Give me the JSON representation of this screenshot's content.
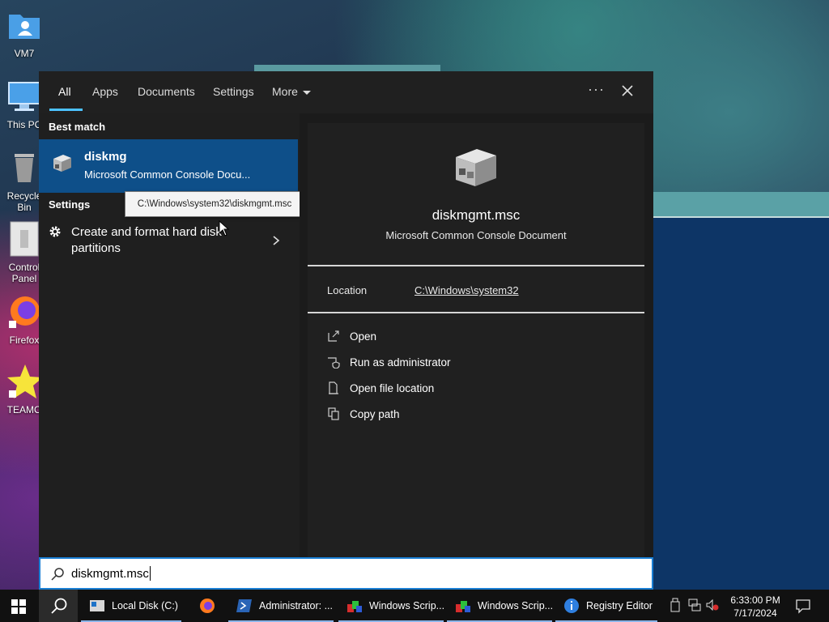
{
  "desktop": {
    "icons": [
      {
        "label": "VM7"
      },
      {
        "label": "This PC"
      },
      {
        "label": "Recycle Bin"
      },
      {
        "label": "Control Panel"
      },
      {
        "label": "Firefox"
      },
      {
        "label": "TEAMO"
      }
    ]
  },
  "search_panel": {
    "tabs": [
      "All",
      "Apps",
      "Documents",
      "Settings",
      "More"
    ],
    "active_tab": "All",
    "more_icon": "chevron-down-icon",
    "options_icon": "ellipsis-icon",
    "close_icon": "close-icon",
    "best_match": {
      "heading": "Best match",
      "title": "diskmg",
      "subtitle": "Microsoft Common Console Docu...",
      "tooltip": "C:\\Windows\\system32\\diskmgmt.msc"
    },
    "settings": {
      "heading": "Settings",
      "item_label": "Create and format hard disk partitions"
    },
    "detail": {
      "title": "diskmgmt.msc",
      "subtitle": "Microsoft Common Console Document",
      "location_label": "Location",
      "location_value": "C:\\Windows\\system32",
      "actions": [
        {
          "label": "Open",
          "icon": "open-icon"
        },
        {
          "label": "Run as administrator",
          "icon": "shield-icon"
        },
        {
          "label": "Open file location",
          "icon": "file-location-icon"
        },
        {
          "label": "Copy path",
          "icon": "copy-icon"
        }
      ]
    }
  },
  "search_box": {
    "value": "diskmgmt.msc"
  },
  "taskbar": {
    "items": [
      {
        "label": "Local Disk (C:)"
      },
      {
        "label": ""
      },
      {
        "label": "Administrator: ..."
      },
      {
        "label": "Windows Scrip..."
      },
      {
        "label": "Windows Scrip..."
      },
      {
        "label": "Registry Editor"
      }
    ],
    "time": "6:33:00 PM",
    "date": "7/17/2024"
  },
  "colors": {
    "accent": "#4cc2ff",
    "selection": "#0e4f89",
    "panel": "#1f1f1f",
    "taskbar": "#111111"
  }
}
